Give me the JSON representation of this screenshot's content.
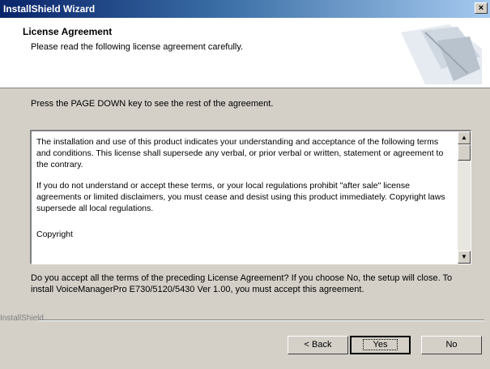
{
  "window": {
    "title": "InstallShield Wizard",
    "close_glyph": "×"
  },
  "header": {
    "title": "License Agreement",
    "subtitle": "Please read the following license agreement carefully."
  },
  "instruction": "Press the PAGE DOWN key to see the rest of the agreement.",
  "license": {
    "paragraphs": [
      "The installation and use of this product indicates your understanding and acceptance of the following terms and conditions. This license shall supersede any verbal, or prior verbal or written, statement or agreement to the contrary.",
      "If you do not understand or accept these terms, or your local regulations prohibit \"after sale\" license agreements or limited disclaimers, you must cease and desist using this product immediately. Copyright laws supersede all local regulations.",
      "Copyright"
    ]
  },
  "accept_question": "Do you accept all the terms of the preceding License Agreement?  If you choose No,  the setup will close.  To install VoiceManagerPro E730/5120/5430 Ver 1.00, you must accept this agreement.",
  "brand": "InstallShield",
  "buttons": {
    "back": "< Back",
    "yes": "Yes",
    "no": "No"
  },
  "icons": {
    "scroll_up": "▲",
    "scroll_down": "▼"
  }
}
